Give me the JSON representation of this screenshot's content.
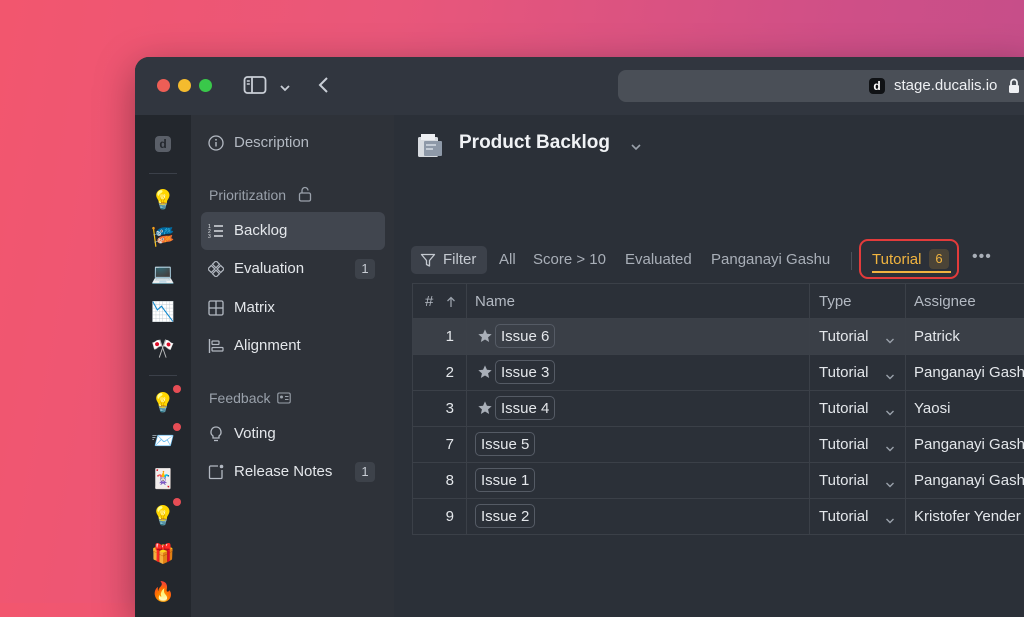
{
  "browser": {
    "url_favicon_letter": "d",
    "url": "stage.ducalis.io"
  },
  "rail": {
    "logo_letter": "d",
    "emojis": [
      "💡",
      "🎏",
      "💻",
      "📉",
      "🎌",
      "💡",
      "📨",
      "🃏",
      "💡",
      "🎁",
      "🔥"
    ]
  },
  "sidebar": {
    "description": "Description",
    "prioritization_heading": "Prioritization",
    "items": [
      {
        "label": "Backlog"
      },
      {
        "label": "Evaluation",
        "count": "1"
      },
      {
        "label": "Matrix"
      },
      {
        "label": "Alignment"
      }
    ],
    "feedback_heading": "Feedback",
    "feedback_items": [
      {
        "label": "Voting"
      },
      {
        "label": "Release Notes",
        "count": "1"
      }
    ]
  },
  "main": {
    "title": "Product Backlog",
    "filters": {
      "filter_label": "Filter",
      "tabs": [
        "All",
        "Score > 10",
        "Evaluated",
        "Panganayi Gashu"
      ],
      "active_tab": "Tutorial",
      "active_count": "6",
      "more": "•••"
    },
    "table": {
      "headers": {
        "num": "#",
        "name": "Name",
        "type": "Type",
        "assignee": "Assignee"
      },
      "rows": [
        {
          "num": "1",
          "starred": true,
          "name": "Issue 6",
          "type": "Tutorial",
          "assignee": "Patrick"
        },
        {
          "num": "2",
          "starred": true,
          "name": "Issue 3",
          "type": "Tutorial",
          "assignee": "Panganayi Gashu"
        },
        {
          "num": "3",
          "starred": true,
          "name": "Issue 4",
          "type": "Tutorial",
          "assignee": "Yaosi"
        },
        {
          "num": "7",
          "starred": false,
          "name": "Issue 5",
          "type": "Tutorial",
          "assignee": "Panganayi Gashu"
        },
        {
          "num": "8",
          "starred": false,
          "name": "Issue 1",
          "type": "Tutorial",
          "assignee": "Panganayi Gashu"
        },
        {
          "num": "9",
          "starred": false,
          "name": "Issue 2",
          "type": "Tutorial",
          "assignee": "Kristofer Yender"
        }
      ]
    }
  },
  "colors": {
    "accent_tab": "#f1b43f",
    "highlight_border": "#e23b3b",
    "notification_dot": "#e64d55"
  }
}
